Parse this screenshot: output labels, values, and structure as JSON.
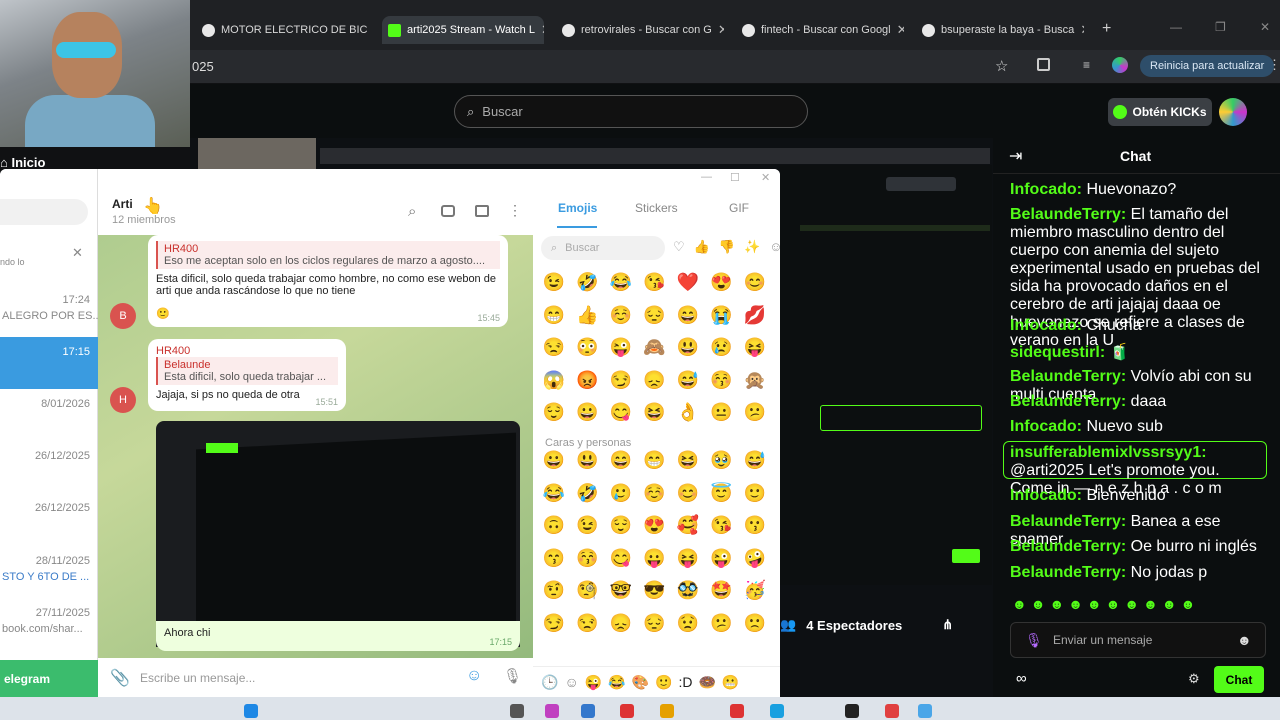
{
  "browser": {
    "tabs": [
      {
        "label": "MOTOR ELECTRICO DE BIC",
        "fav_color": "#4285f4"
      },
      {
        "label": "arti2025 Stream - Watch L",
        "fav_color": "#53fc18"
      },
      {
        "label": "retrovirales - Buscar con G",
        "fav_color": "#4285f4"
      },
      {
        "label": "fintech - Buscar con Googl",
        "fav_color": "#4285f4"
      },
      {
        "label": "bsuperaste la baya - Busca",
        "fav_color": "#4285f4"
      }
    ],
    "address_fragment": "025",
    "update_button": "Reinicia para actualizar"
  },
  "kick": {
    "search_placeholder": "Buscar",
    "kicks_button": "Obtén KICKs",
    "nav_home": "Inicio",
    "spectators": "4 Espectadores",
    "accent": "#53fc18"
  },
  "telegram": {
    "list": [
      {
        "time": "17:24",
        "sub": "ALEGRO POR ES..."
      },
      {
        "time": "17:15",
        "sub": ""
      },
      {
        "time": "8/01/2026",
        "sub": ""
      },
      {
        "time": "26/12/2025",
        "sub": ""
      },
      {
        "time": "26/12/2025",
        "sub": ""
      },
      {
        "time": "28/11/2025",
        "sub": "STO Y 6TO DE ..."
      },
      {
        "time": "27/11/2025",
        "sub": "book.com/shar..."
      }
    ],
    "list_hint": "ndo lo",
    "telegram_label": "elegram",
    "chat_title": "Arti",
    "chat_members": "12 miembros",
    "messages": {
      "m1_quote_name": "HR400",
      "m1_quote_text": "Eso me aceptan solo en los ciclos regulares de marzo a agosto....",
      "m1_text": "Esta dificil, solo queda trabajar como hombre, no como ese webon de arti que anda rascándose lo que no tiene",
      "m1_time": "15:45",
      "m2_sender": "HR400",
      "m2_quote_name": "Belaunde",
      "m2_quote_text": "Esta dificil, solo queda trabajar ...",
      "m2_text": "Jajaja, si ps no queda de otra",
      "m2_time": "15:51",
      "m3_caption": "Ahora chi",
      "m3_time": "17:15"
    },
    "avatar_b": "B",
    "avatar_h": "H",
    "input_placeholder": "Escribe un mensaje...",
    "emoji_tabs": [
      "Emojis",
      "Stickers",
      "GIF"
    ],
    "emoji_search": "Buscar",
    "emoji_section": "Caras y personas",
    "emojis_row1": [
      "😉",
      "🤣",
      "😂",
      "😘",
      "❤️",
      "😍",
      "😊"
    ],
    "emojis_row2": [
      "😁",
      "👍",
      "☺️",
      "😔",
      "😄",
      "😭",
      "💋"
    ],
    "emojis_row3": [
      "😒",
      "😳",
      "😜",
      "🙈",
      "😃",
      "😢",
      "😝"
    ],
    "emojis_row4": [
      "😱",
      "😡",
      "😏",
      "😞",
      "😅",
      "😚",
      "🙊"
    ],
    "emojis_row5": [
      "😌",
      "😀",
      "😋",
      "😆",
      "👌",
      "😐",
      "😕"
    ],
    "emojis_row6": [
      "😀",
      "😃",
      "😄",
      "😁",
      "😆",
      "🥹",
      "😅"
    ],
    "emojis_row7": [
      "😂",
      "🤣",
      "🥲",
      "☺️",
      "😊",
      "😇",
      "🙂"
    ],
    "emojis_row8": [
      "🙃",
      "😉",
      "😌",
      "😍",
      "🥰",
      "😘",
      "😗"
    ],
    "emojis_row9": [
      "😙",
      "😚",
      "😋",
      "😛",
      "😝",
      "😜",
      "🤪"
    ],
    "emojis_row10": [
      "🤨",
      "🧐",
      "🤓",
      "😎",
      "🥸",
      "🤩",
      "🥳"
    ],
    "emojis_row11": [
      "😏",
      "😒",
      "😞",
      "😔",
      "😟",
      "😕",
      "🙁"
    ]
  },
  "chat": {
    "title": "Chat",
    "messages": [
      {
        "user": "Infocado",
        "text": "Huevonazo?"
      },
      {
        "user": "BelaundeTerry",
        "text": "El tamaño del miembro masculino dentro del cuerpo con anemia del sujeto experimental usado en pruebas del sida ha provocado daños en el cerebro de arti jajajaj daaa oe huevonazo se refiere a clases de verano en la U"
      },
      {
        "user": "Infocado",
        "text": "Chucha"
      },
      {
        "user": "sidequestirl",
        "text": "🧃"
      },
      {
        "user": "BelaundeTerry",
        "text": "Volvío abi con su multi cuenta"
      },
      {
        "user": "BelaundeTerry",
        "text": "daaa"
      },
      {
        "user": "Infocado",
        "text": "Nuevo sub"
      },
      {
        "user": "insufferablemixlvssrsyy1",
        "text": "@arti2025 Let's promote you. Come in — n e z h n a . c o m"
      },
      {
        "user": "Infocado",
        "text": "Bienvenido"
      },
      {
        "user": "BelaundeTerry",
        "text": "Banea a ese spamer"
      },
      {
        "user": "BelaundeTerry",
        "text": "Oe burro ni inglés"
      },
      {
        "user": "BelaundeTerry",
        "text": "No jodas p"
      }
    ],
    "input_placeholder": "Enviar un mensaje",
    "send_label": "Chat"
  }
}
